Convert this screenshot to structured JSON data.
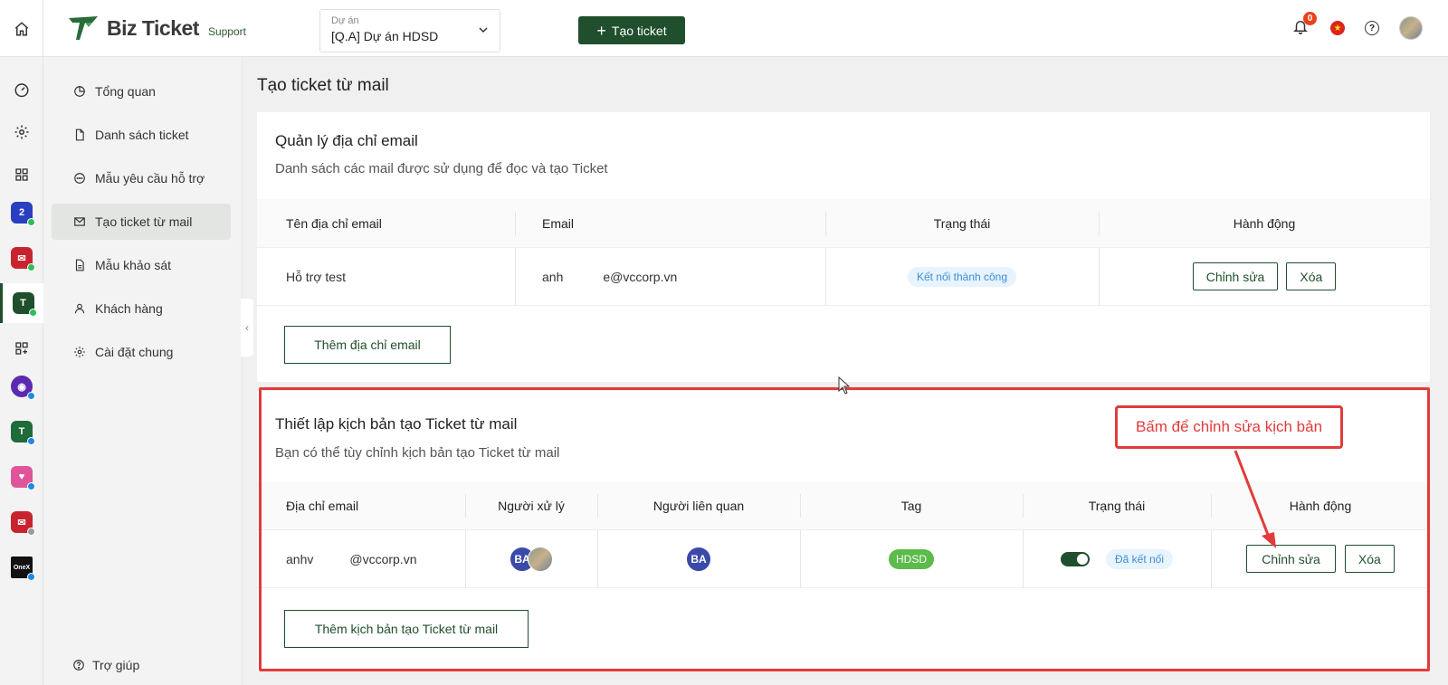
{
  "header": {
    "logo_text": "Biz Ticket",
    "logo_sub": "Support",
    "project_label": "Dự án",
    "project_value": "[Q.A] Dự án HDSD",
    "create_button": "Tạo ticket",
    "notification_count": "0",
    "help_glyph": "?"
  },
  "rail": {
    "apps": [
      "dashboard-icon",
      "settings-icon",
      "grid-icon",
      "app-2",
      "app-mail",
      "app-bizticket",
      "add-app-icon",
      "app-bot",
      "app-ticket-2",
      "app-heart",
      "app-mail-2",
      "app-onex"
    ],
    "onex_label": "OneX"
  },
  "sidebar": {
    "items": [
      {
        "label": "Tổng quan",
        "icon": "pie-chart-icon"
      },
      {
        "label": "Danh sách ticket",
        "icon": "document-icon"
      },
      {
        "label": "Mẫu yêu cầu hỗ trợ",
        "icon": "chat-icon"
      },
      {
        "label": "Tạo ticket từ mail",
        "icon": "mail-icon"
      },
      {
        "label": "Mẫu khảo sát",
        "icon": "survey-icon"
      },
      {
        "label": "Khách hàng",
        "icon": "user-icon"
      },
      {
        "label": "Cài đặt chung",
        "icon": "gear-icon"
      }
    ],
    "active_index": 3,
    "help_label": "Trợ giúp"
  },
  "page": {
    "title": "Tạo ticket từ mail"
  },
  "email_section": {
    "title": "Quản lý địa chỉ email",
    "description": "Danh sách các mail được sử dụng để đọc và tạo Ticket",
    "columns": [
      "Tên địa chỉ email",
      "Email",
      "Trạng thái",
      "Hành động"
    ],
    "rows": [
      {
        "name": "Hỗ trợ test",
        "email_prefix": "anh",
        "email_suffix": "e@vccorp.vn",
        "status": "Kết nối thành công",
        "edit": "Chỉnh sửa",
        "delete": "Xóa"
      }
    ],
    "add_button": "Thêm địa chỉ email"
  },
  "script_section": {
    "title": "Thiết lập kịch bản tạo Ticket từ mail",
    "description": "Bạn có thể tùy chỉnh kịch bản tạo Ticket từ mail",
    "columns": [
      "Địa chỉ email",
      "Người xử lý",
      "Người liên quan",
      "Tag",
      "Trạng thái",
      "Hành động"
    ],
    "rows": [
      {
        "email_prefix": "anhv",
        "email_suffix": "@vccorp.vn",
        "handler_initials": "BA",
        "related_initials": "BA",
        "tag": "HDSD",
        "toggle_on": true,
        "status": "Đã kết nối",
        "edit": "Chỉnh sửa",
        "delete": "Xóa"
      }
    ],
    "add_button": "Thêm kịch bản tạo Ticket từ mail"
  },
  "annotation": {
    "callout": "Bấm để chỉnh sửa kịch bản"
  },
  "colors": {
    "brand_green": "#1f4f2c",
    "annotation_red": "#e23b3b",
    "status_blue": "#3b8fd6",
    "tag_green": "#5cbb4a"
  }
}
